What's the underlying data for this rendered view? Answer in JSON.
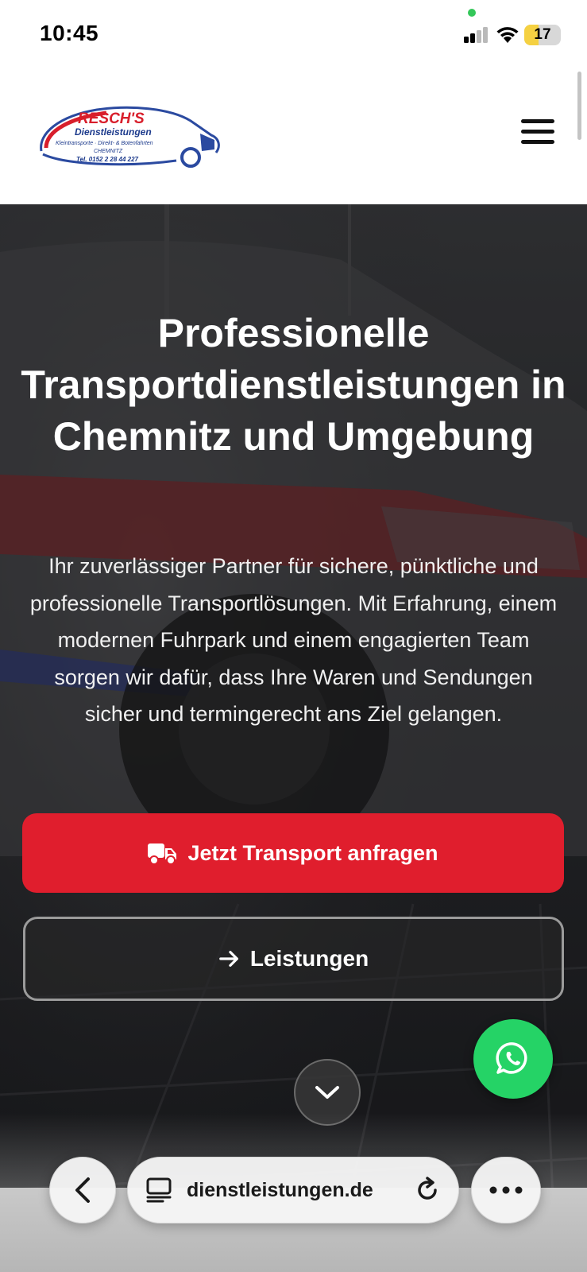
{
  "status_bar": {
    "time": "10:45",
    "battery": "17",
    "icons": [
      "signal-icon",
      "wifi-icon",
      "battery-icon"
    ]
  },
  "header": {
    "logo": {
      "name": "RESCH'S",
      "subtitle": "Dienstleistungen",
      "tagline": "Kleintransporte · Direkt- & Botenfahrten",
      "city": "CHEMNITZ",
      "phone": "Tel. 0152 2 28 44 227"
    },
    "menu_icon": "hamburger-icon"
  },
  "hero": {
    "title": "Professionelle Transportdienstleistungen in Chemnitz und Umgebung",
    "text": "Ihr zuverlässiger Partner für sichere, pünktliche und professionelle Transportlösungen. Mit Erfahrung, einem modernen Fuhrpark und einem engagierten Team sorgen wir dafür, dass Ihre Waren und Sendungen sicher und termingerecht ans Ziel gelangen.",
    "primary_button": "Jetzt Transport anfragen",
    "secondary_button": "Leistungen",
    "colors": {
      "primary": "#e01e2d",
      "whatsapp": "#25d366"
    }
  },
  "browser": {
    "url": "dienstleistungen.de",
    "icons": [
      "back-icon",
      "tabs-icon",
      "reload-icon",
      "more-icon"
    ]
  }
}
